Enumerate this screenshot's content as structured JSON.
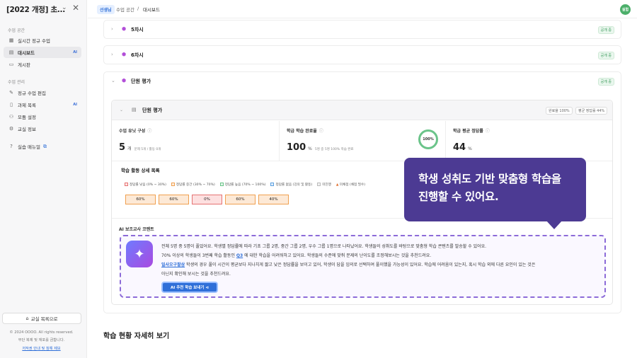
{
  "sidebar": {
    "title": "[2022 개정] 초...",
    "section_class": "수업 공간",
    "section_manage": "수업 관리",
    "items": [
      {
        "label": "실시간 정규 수업",
        "icon": "▦"
      },
      {
        "label": "대시보드",
        "icon": "▤",
        "badge": "AI",
        "active": true
      },
      {
        "label": "게시판",
        "icon": "▭"
      },
      {
        "label": "정규 수업 편집",
        "icon": "✎"
      },
      {
        "label": "과제 목록",
        "icon": "▯",
        "badge": "AI"
      },
      {
        "label": "모둠 설정",
        "icon": "⚇"
      },
      {
        "label": "교실 정보",
        "icon": "⚙"
      },
      {
        "label": "실습 매뉴얼",
        "icon": "?"
      }
    ],
    "classroom_list_button": "교실 목록으로",
    "footer": {
      "copyright": "© 2024 OOOO. All rights reserved.",
      "notice": "무단 복제 및 재포를 금합니다.",
      "policy_link": "저작권 안내 및 침해 제보"
    }
  },
  "topbar": {
    "badge": "선생님",
    "crumbs": [
      "수업 공간",
      "대시보드"
    ],
    "avatar": "실험"
  },
  "accordions": [
    {
      "title": "5차시",
      "badge": "공개 중"
    },
    {
      "title": "6차시",
      "badge": "공개 중"
    },
    {
      "title": "단원 평가",
      "badge": "공개 중"
    }
  ],
  "unit_card": {
    "title": "단원 평가",
    "pill_complete": "완료율 100%",
    "pill_accuracy": "평균 정답률 44%",
    "stats": [
      {
        "label": "수업 유닛 구성",
        "value": "5",
        "unit": "개",
        "sub": "문제 5개 / 활동 0개"
      },
      {
        "label": "학급 학습 완료율",
        "value": "100",
        "unit": "%",
        "sub": "5명 중 5명 100% 학습 완료",
        "ring": "100%"
      },
      {
        "label": "학급 평균 정답률",
        "value": "44",
        "unit": "%"
      }
    ],
    "detail_title": "학습 활동 상세 목록",
    "legend": [
      {
        "label": "정답률 낮음 (0% ~ 30%)",
        "color": "#e57373"
      },
      {
        "label": "정답률 중간 (30% ~ 70%)",
        "color": "#f0a050"
      },
      {
        "label": "정답률 높음 (70% ~ 100%)",
        "color": "#6bc48a"
      },
      {
        "label": "정답률 없음 (강의 및 활동)",
        "color": "#5aa0e0"
      },
      {
        "label": "미진행",
        "color": "#bbbbbb"
      },
      {
        "label": "미채점 (채점 필수)",
        "color": "#e07030"
      }
    ],
    "cells": [
      {
        "value": "60%",
        "level": "mid"
      },
      {
        "value": "60%",
        "level": "mid"
      },
      {
        "value": "0%",
        "level": "low"
      },
      {
        "value": "60%",
        "level": "mid"
      },
      {
        "value": "40%",
        "level": "mid"
      }
    ],
    "ai_comment_title": "AI 보조교사 코멘트",
    "ai_lines": [
      "전체 5명 중 5명이 풀었어요. 학생별 정답률에 따라 기초 그룹 2명, 중간 그룹 2명, 우수 그룹 1명으로 나타났어요. 학생들의 성취도를 바탕으로 맞춤형 학습 콘텐츠를 발송할 수 있어요.",
      "에 대한 학습을 어려워하고 있어요. 학생들의 수준에 맞춰 문제의 난이도를 조정해보시는 것을 추천드려요.",
      "학생의 경우 풀이 시간이 평균보다 지나치게 짧고 낮은 정답률을 보이고 있어, 학생이 답을 임의로 선택하여 풀이했을 가능성이 있어요. 학습에 어려움이 있는지, 혹시 학습 외에 다른 요인이 있는 것은",
      "아닌지 확인해 보시는 것을 추천드려요."
    ],
    "ai_line2_prefix": "70% 이상의 학생들이 3번째 학습 활동인",
    "ai_q_link": "Q3",
    "ai_student_link": "일사오구팔삼",
    "ai_button": "AI 추천 학습 보내기 ⊲"
  },
  "bottom_title": "학습 현황 자세히 보기",
  "tooltip": {
    "line1": "학생 성취도 기반 맞춤형 학습을",
    "line2": "진행할 수 있어요."
  }
}
